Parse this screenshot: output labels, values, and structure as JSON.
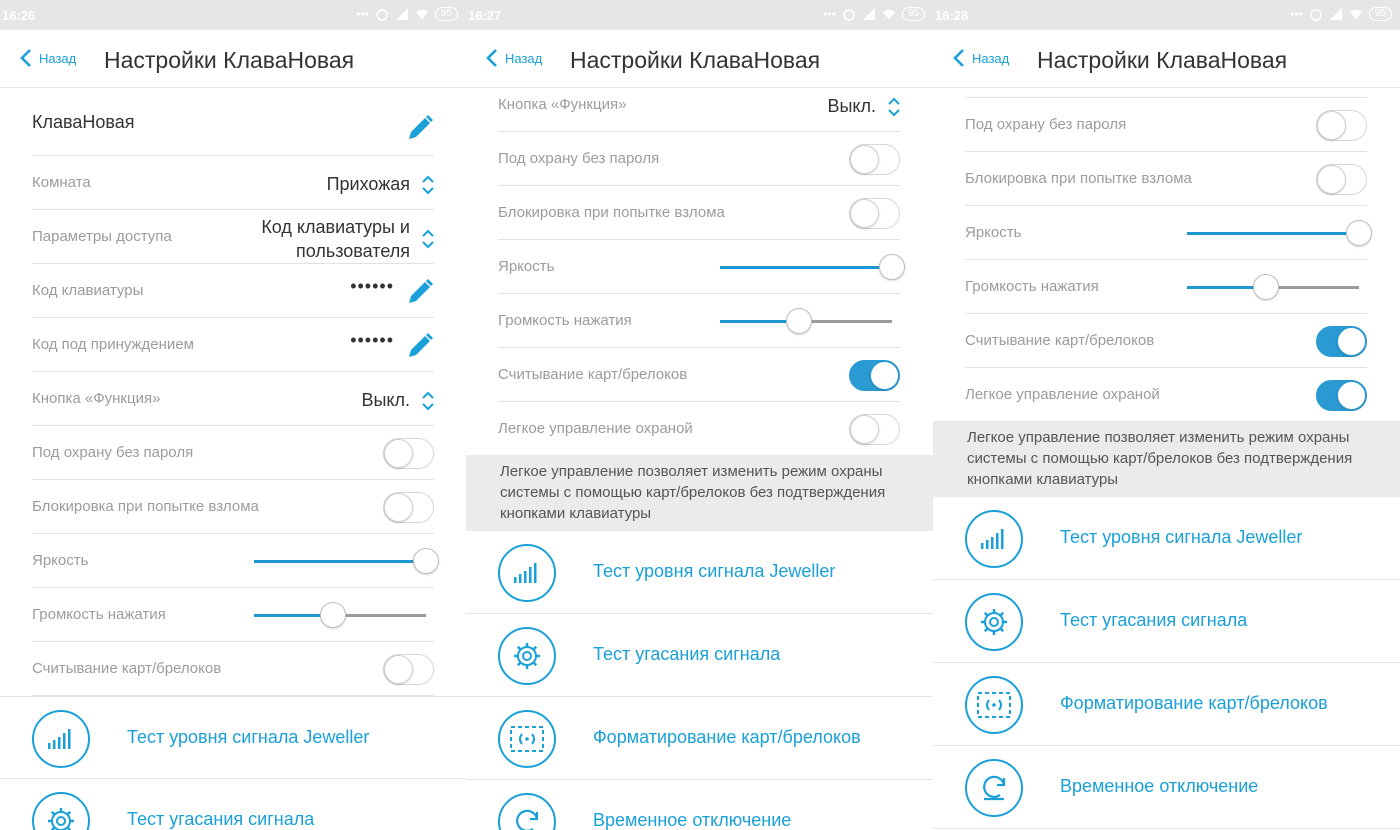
{
  "colors": {
    "accent": "#1aa0d8",
    "toggle_on": "#2a9ad2",
    "note_bg": "#ebebeb"
  },
  "panels": [
    {
      "status_time": "16:26",
      "battery": "95",
      "back_label": "Назад",
      "title": "Настройки КлаваНовая",
      "device_name": "КлаваНовая",
      "room_label": "Комната",
      "room_value": "Прихожая",
      "access_label": "Параметры доступа",
      "access_value": "Код клавиатуры и пользователя",
      "kb_code_label": "Код клавиатуры",
      "kb_code_value": "••••••",
      "duress_label": "Код под принуждением",
      "duress_value": "••••••",
      "func_label": "Кнопка «Функция»",
      "func_value": "Выкл.",
      "nopass_label": "Под охрану без пароля",
      "nopass_on": false,
      "block_label": "Блокировка при попытке взлома",
      "block_on": false,
      "bright_label": "Яркость",
      "bright_level": 1.0,
      "volume_label": "Громкость нажатия",
      "volume_level": 0.46,
      "cards_label": "Считывание карт/брелоков",
      "cards_on": false,
      "act1": "Тест уровня сигнала Jeweller",
      "act2": "Тест угасания сигнала"
    },
    {
      "status_time": "16:27",
      "battery": "95",
      "back_label": "Назад",
      "title": "Настройки КлаваНовая",
      "func_label": "Кнопка «Функция»",
      "func_value": "Выкл.",
      "nopass_label": "Под охрану без пароля",
      "nopass_on": false,
      "block_label": "Блокировка при попытке взлома",
      "block_on": false,
      "bright_label": "Яркость",
      "bright_level": 1.0,
      "volume_label": "Громкость нажатия",
      "volume_level": 0.46,
      "cards_label": "Считывание карт/брелоков",
      "cards_on": true,
      "easy_label": "Легкое управление охраной",
      "easy_on": false,
      "note": "Легкое управление позволяет изменить режим охраны системы с помощью карт/брелоков без подтверждения кнопками клавиатуры",
      "act1": "Тест уровня сигнала Jeweller",
      "act2": "Тест угасания сигнала",
      "act3": "Форматирование карт/брелоков",
      "act4": "Временное отключение"
    },
    {
      "status_time": "16:28",
      "battery": "95",
      "back_label": "Назад",
      "title": "Настройки КлаваНовая",
      "nopass_label": "Под охрану без пароля",
      "nopass_on": false,
      "block_label": "Блокировка при попытке взлома",
      "block_on": false,
      "bright_label": "Яркость",
      "bright_level": 1.0,
      "volume_label": "Громкость нажатия",
      "volume_level": 0.46,
      "cards_label": "Считывание карт/брелоков",
      "cards_on": true,
      "easy_label": "Легкое управление охраной",
      "easy_on": true,
      "note": "Легкое управление позволяет изменить режим охраны системы с помощью карт/брелоков без подтверждения кнопками клавиатуры",
      "act1": "Тест уровня сигнала Jeweller",
      "act2": "Тест угасания сигнала",
      "act3": "Форматирование карт/брелоков",
      "act4": "Временное отключение"
    }
  ]
}
